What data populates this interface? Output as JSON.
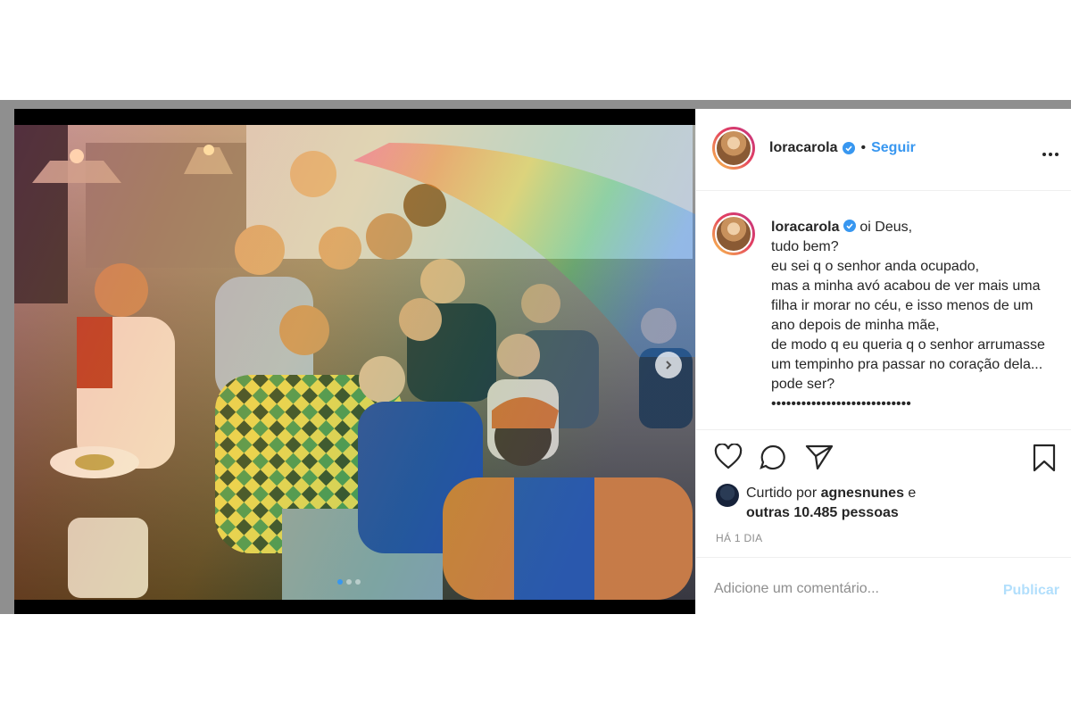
{
  "post": {
    "username": "loracarola",
    "follow_label": "Seguir",
    "separator": "•",
    "more_icon": "more-icon",
    "verified_icon": "verified-badge-icon"
  },
  "caption": {
    "username": "loracarola",
    "text": "oi Deus,\ntudo bem?\neu sei q o senhor anda ocupado,\nmas a minha avó acabou de ver mais uma filha ir morar no céu, e isso menos de um ano depois de minha mãe,\nde modo q eu queria q o senhor arrumasse um tempinho pra passar no coração dela... pode ser?\n••••••••••••••••••••••••••••"
  },
  "likes": {
    "prefix": "Curtido por",
    "user": "agnesnunes",
    "connector": "e",
    "others": "outras 10.485 pessoas"
  },
  "timestamp": "HÁ 1 DIA",
  "comment": {
    "placeholder": "Adicione um comentário...",
    "publish_label": "Publicar"
  },
  "carousel": {
    "slide_count": 3,
    "active_slide": 1
  },
  "colors": {
    "accent": "#3897f0",
    "text": "#262626",
    "muted": "#8e8e8e",
    "publish_disabled": "#b2dffc",
    "bezel": "#8f8f8f"
  }
}
